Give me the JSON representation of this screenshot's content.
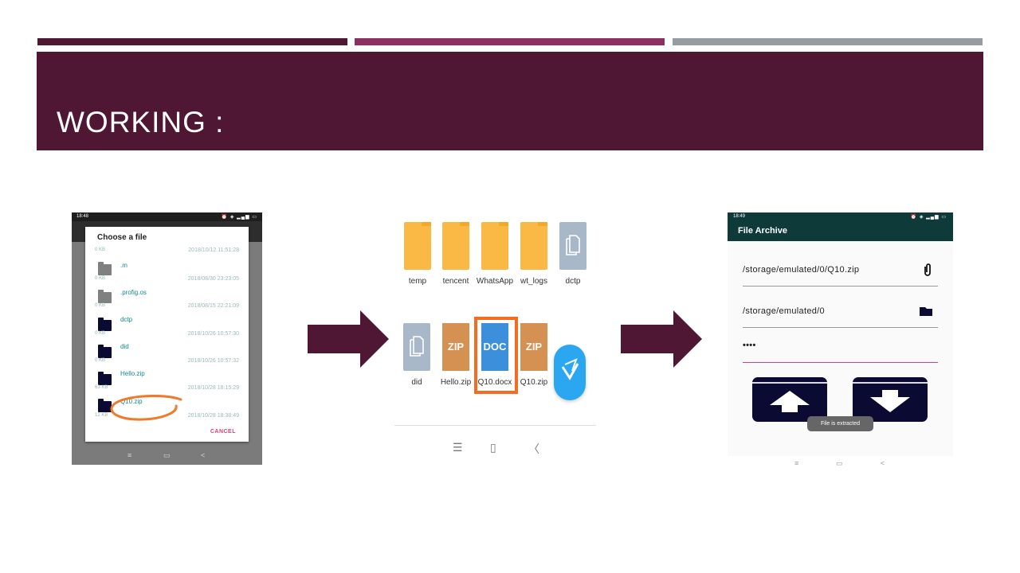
{
  "slide": {
    "title": "WORKING :",
    "colors": {
      "band": "#4f1734",
      "stripe1": "#4f1734",
      "stripe2": "#8c2f62",
      "stripe3": "#969ca2",
      "arrow": "#4f1734"
    }
  },
  "screen1": {
    "status_time": "18:48",
    "status_icons": "⏰ ◈ ▂▄▆ ▭",
    "dialog_title": "Choose a file",
    "files": [
      {
        "name": "",
        "size": "0 KB",
        "date": "2018/10/12 11:51:28",
        "icon": "gray-folder-icon"
      },
      {
        "name": ".m",
        "size": "0 KB",
        "date": "2018/08/30 23:23:05",
        "icon": "gray-folder-icon"
      },
      {
        "name": ".profig.os",
        "size": "0 KB",
        "date": "2018/08/15 22:21:09",
        "icon": "gray-folder-icon"
      },
      {
        "name": "dctp",
        "size": "0 KB",
        "date": "2018/10/26 10:57:30",
        "icon": "dark-folder-icon"
      },
      {
        "name": "did",
        "size": "0 KB",
        "date": "2018/10/26 10:57:32",
        "icon": "dark-folder-icon"
      },
      {
        "name": "Hello.zip",
        "size": "63 KB",
        "date": "2018/10/28 18:15:29",
        "icon": "dark-file-icon"
      },
      {
        "name": "Q10.zip",
        "size": "12 KB",
        "date": "2018/10/28 18:38:49",
        "icon": "dark-file-icon"
      }
    ],
    "cancel_label": "CANCEL",
    "nav": {
      "menu": "≡",
      "home": "▭",
      "back": "<"
    }
  },
  "screen2": {
    "row1": [
      {
        "label": "temp",
        "kind": "folder"
      },
      {
        "label": "tencent",
        "kind": "folder"
      },
      {
        "label": "WhatsApp",
        "kind": "folder"
      },
      {
        "label": "wt_logs",
        "kind": "folder"
      },
      {
        "label": "dctp",
        "kind": "document"
      }
    ],
    "row2": [
      {
        "label": "did",
        "kind": "document",
        "badge": ""
      },
      {
        "label": "Hello.zip",
        "kind": "zip",
        "badge": "ZIP"
      },
      {
        "label": "Q10.docx",
        "kind": "doc",
        "badge": "DOC"
      },
      {
        "label": "Q10.zip",
        "kind": "zip",
        "badge": "ZIP"
      }
    ],
    "nav": {
      "menu": "☰",
      "home": "▯",
      "back": "〈"
    }
  },
  "screen3": {
    "status_time": "18:49",
    "status_icons": "⏰ ◈ ▂▄▆ ▭",
    "app_title": "File Archive",
    "source_path": "/storage/emulated/0/Q10.zip",
    "dest_path": "/storage/emulated/0",
    "password_value": "••••",
    "toast": "File is extracted",
    "nav": {
      "menu": "≡",
      "home": "▭",
      "back": "<"
    }
  }
}
